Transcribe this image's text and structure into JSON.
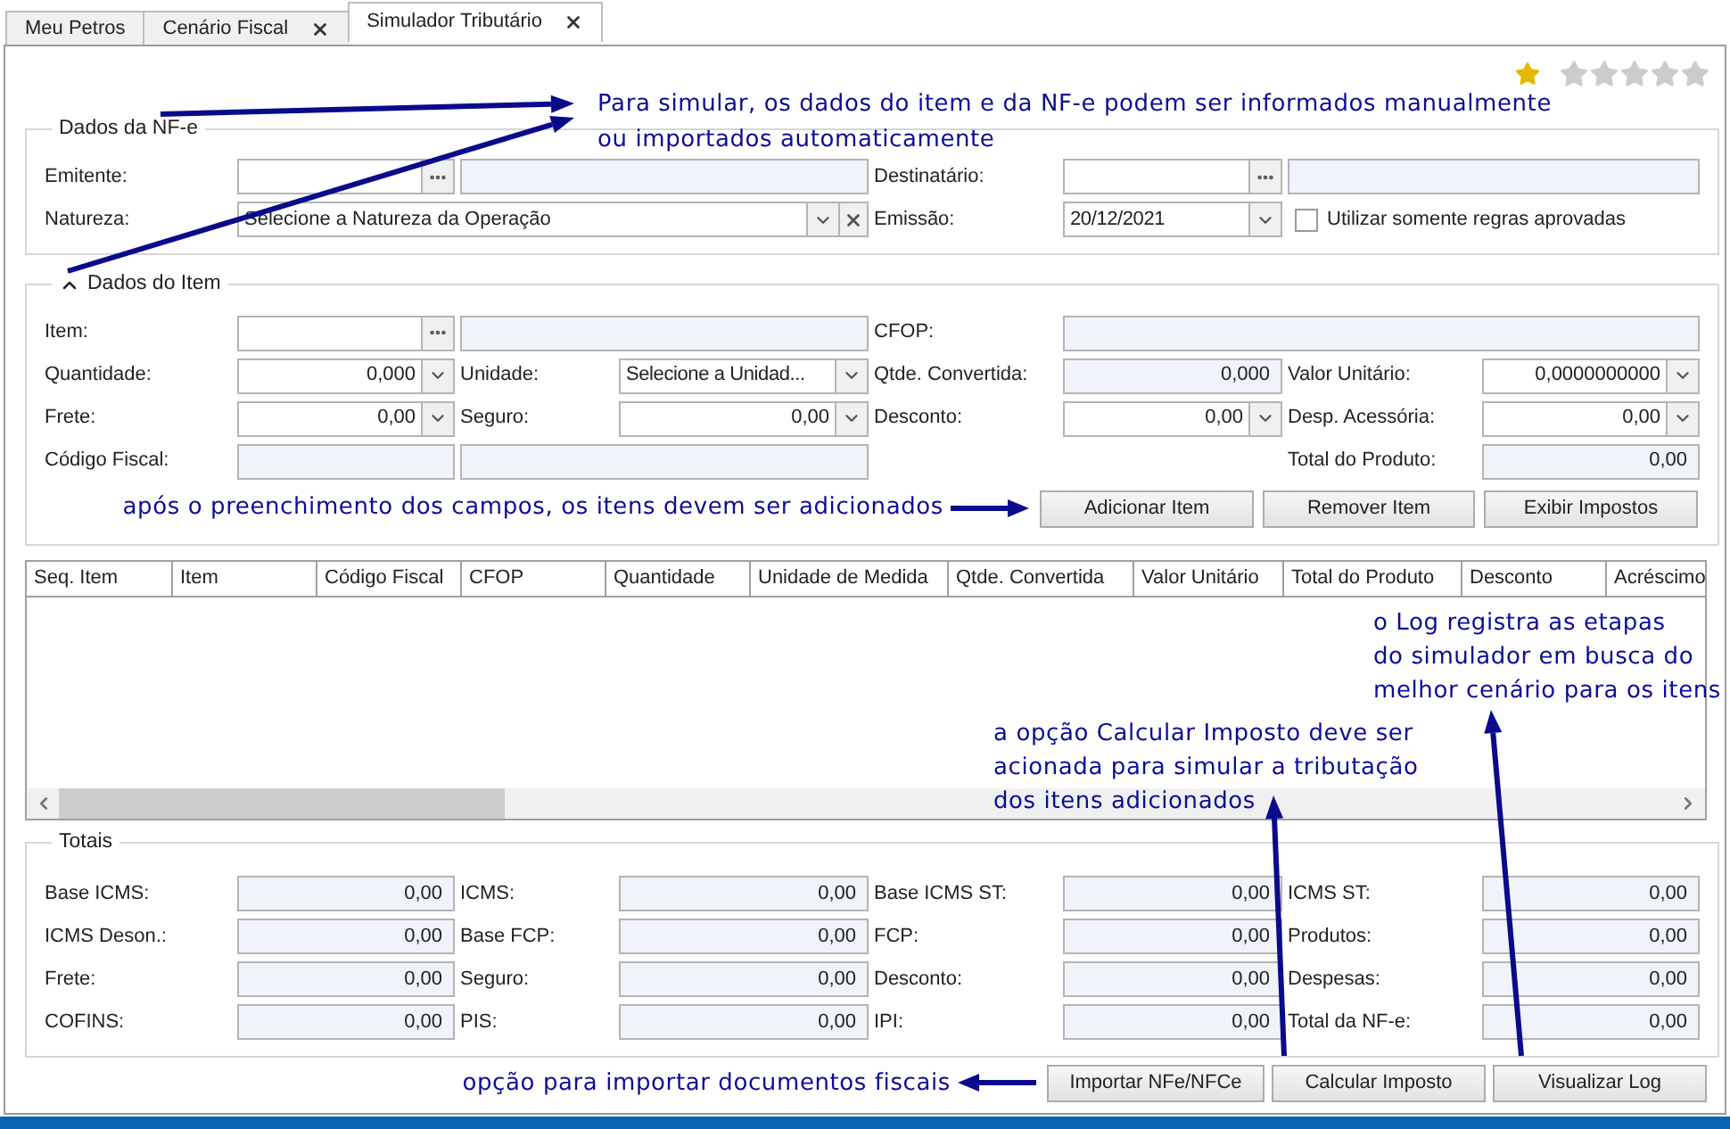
{
  "tabs": [
    {
      "label": "Meu Petros",
      "selected": false,
      "closable": false
    },
    {
      "label": "Cenário Fiscal",
      "selected": false,
      "closable": true
    },
    {
      "label": "Simulador Tributário",
      "selected": true,
      "closable": true
    }
  ],
  "favorite": {
    "on": true
  },
  "rating": {
    "stars": 0
  },
  "note_data_entry": [
    "Para simular, os dados do item e da NF-e podem ser informados manualmente",
    "ou importados automaticamente"
  ],
  "nfe": {
    "title": "Dados da NF-e",
    "rows": [
      [
        {
          "kind": "label",
          "text": "Emitente:"
        },
        {
          "kind": "lookup"
        },
        {
          "kind": "readonly-wide"
        },
        "",
        {
          "kind": "label",
          "text": "Destinatário:"
        },
        {
          "kind": "lookup"
        },
        {
          "kind": "readonly-wide"
        },
        ""
      ],
      [
        {
          "kind": "label",
          "text": "Natureza:"
        },
        {
          "kind": "select-clear",
          "value": "Selecione a Natureza da Operação"
        },
        "",
        "",
        {
          "kind": "label",
          "text": "Emissão:"
        },
        {
          "kind": "select",
          "value": "20/12/2021"
        },
        {
          "kind": "checkbox",
          "label": "Utilizar somente regras aprovadas",
          "checked": false
        },
        ""
      ]
    ]
  },
  "item": {
    "title": "Dados do Item",
    "expanded": true,
    "rows": [
      [
        {
          "kind": "label",
          "text": "Item:"
        },
        {
          "kind": "lookup"
        },
        {
          "kind": "readonly-wide"
        },
        "",
        {
          "kind": "label",
          "text": "CFOP:"
        },
        {
          "kind": "readonly-full"
        },
        "",
        ""
      ],
      [
        {
          "kind": "label",
          "text": "Quantidade:"
        },
        {
          "kind": "spin",
          "value": "0,000"
        },
        {
          "kind": "label",
          "text": "Unidade:"
        },
        {
          "kind": "select",
          "value": "Selecione a Unidad..."
        },
        {
          "kind": "label",
          "text": "Qtde. Convertida:"
        },
        {
          "kind": "readonly",
          "value": "0,000"
        },
        {
          "kind": "label",
          "text": "Valor Unitário:"
        },
        {
          "kind": "spin",
          "value": "0,0000000000"
        }
      ],
      [
        {
          "kind": "label",
          "text": "Frete:"
        },
        {
          "kind": "spin",
          "value": "0,00"
        },
        {
          "kind": "label",
          "text": "Seguro:"
        },
        {
          "kind": "spin",
          "value": "0,00"
        },
        {
          "kind": "label",
          "text": "Desconto:"
        },
        {
          "kind": "spin",
          "value": "0,00"
        },
        {
          "kind": "label",
          "text": "Desp. Acessória:"
        },
        {
          "kind": "spin",
          "value": "0,00"
        }
      ],
      [
        {
          "kind": "label",
          "text": "Código Fiscal:"
        },
        {
          "kind": "readonly"
        },
        {
          "kind": "readonly-wide"
        },
        "",
        "",
        "",
        {
          "kind": "label",
          "text": "Total do Produto:"
        },
        {
          "kind": "readonly",
          "value": "0,00"
        }
      ]
    ],
    "note": "após o preenchimento dos campos, os itens devem ser adicionados",
    "buttons": [
      "Adicionar Item",
      "Remover Item",
      "Exibir Impostos"
    ]
  },
  "table": {
    "columns": [
      "Seq. Item",
      "Item",
      "Código Fiscal",
      "CFOP",
      "Quantidade",
      "Unidade de Medida",
      "Qtde. Convertida",
      "Valor Unitário",
      "Total do Produto",
      "Desconto",
      "Acréscimo"
    ]
  },
  "note_log": [
    "o Log registra as etapas",
    "do simulador em busca do",
    "melhor cenário para os itens"
  ],
  "note_calculate": [
    "a opção Calcular Imposto deve ser",
    "acionada para simular a tributação",
    "dos itens adicionados"
  ],
  "totals": {
    "title": "Totais",
    "rows": [
      [
        {
          "kind": "label",
          "text": "Base ICMS:"
        },
        {
          "kind": "readonly",
          "value": "0,00"
        },
        {
          "kind": "label",
          "text": "ICMS:"
        },
        {
          "kind": "readonly",
          "value": "0,00"
        },
        {
          "kind": "label",
          "text": "Base ICMS ST:"
        },
        {
          "kind": "readonly",
          "value": "0,00"
        },
        {
          "kind": "label",
          "text": "ICMS ST:"
        },
        {
          "kind": "readonly",
          "value": "0,00"
        }
      ],
      [
        {
          "kind": "label",
          "text": "ICMS Deson.:"
        },
        {
          "kind": "readonly",
          "value": "0,00"
        },
        {
          "kind": "label",
          "text": "Base FCP:"
        },
        {
          "kind": "readonly",
          "value": "0,00"
        },
        {
          "kind": "label",
          "text": "FCP:"
        },
        {
          "kind": "readonly",
          "value": "0,00"
        },
        {
          "kind": "label",
          "text": "Produtos:"
        },
        {
          "kind": "readonly",
          "value": "0,00"
        }
      ],
      [
        {
          "kind": "label",
          "text": "Frete:"
        },
        {
          "kind": "readonly",
          "value": "0,00"
        },
        {
          "kind": "label",
          "text": "Seguro:"
        },
        {
          "kind": "readonly",
          "value": "0,00"
        },
        {
          "kind": "label",
          "text": "Desconto:"
        },
        {
          "kind": "readonly",
          "value": "0,00"
        },
        {
          "kind": "label",
          "text": "Despesas:"
        },
        {
          "kind": "readonly",
          "value": "0,00"
        }
      ],
      [
        {
          "kind": "label",
          "text": "COFINS:"
        },
        {
          "kind": "readonly",
          "value": "0,00"
        },
        {
          "kind": "label",
          "text": "PIS:"
        },
        {
          "kind": "readonly",
          "value": "0,00"
        },
        {
          "kind": "label",
          "text": "IPI:"
        },
        {
          "kind": "readonly",
          "value": "0,00"
        },
        {
          "kind": "label",
          "text": "Total da NF-e:"
        },
        {
          "kind": "readonly",
          "value": "0,00"
        }
      ]
    ]
  },
  "note_import": "opção para importar documentos fiscais",
  "buttons": [
    "Importar NFe/NFCe",
    "Calcular Imposto",
    "Visualizar Log"
  ]
}
